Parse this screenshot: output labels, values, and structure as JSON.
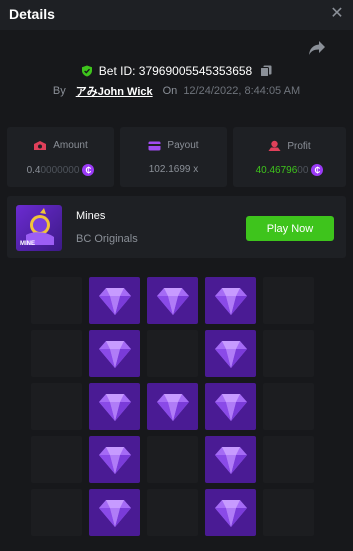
{
  "header": {
    "title": "Details"
  },
  "bet": {
    "id_label": "Bet ID: 379690055453536​58",
    "by_label": "By",
    "user": "アみJohn Wick",
    "on_label": "On",
    "datetime": "12/24/2022, 8:44:05 AM"
  },
  "stats": {
    "amount": {
      "label": "Amount",
      "value_main": "0.4",
      "value_dim": "0000000"
    },
    "payout": {
      "label": "Payout",
      "value": "102.1699 x"
    },
    "profit": {
      "label": "Profit",
      "value": "40.46796",
      "value_dim": "00"
    }
  },
  "game": {
    "name": "Mines",
    "provider": "BC Originals",
    "thumb_label": "MINE",
    "play_label": "Play Now"
  },
  "board": [
    [
      false,
      true,
      true,
      true,
      false
    ],
    [
      false,
      true,
      false,
      true,
      false
    ],
    [
      false,
      true,
      true,
      true,
      false
    ],
    [
      false,
      true,
      false,
      true,
      false
    ],
    [
      false,
      true,
      false,
      true,
      false
    ]
  ],
  "colors": {
    "accent": "#3ec41c",
    "gem": "#4a1b94",
    "coin": "#9b3af7",
    "profit": "#3ec41c"
  },
  "icons": [
    "close-icon",
    "share-icon",
    "shield-icon",
    "copy-icon",
    "amount-icon",
    "payout-icon",
    "profit-icon",
    "coin-icon",
    "gem-icon"
  ]
}
